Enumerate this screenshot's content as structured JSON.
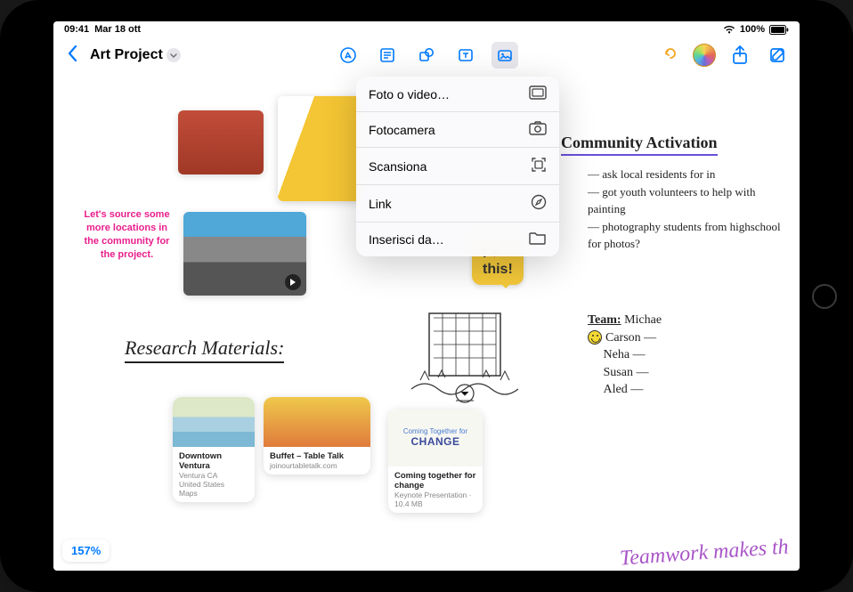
{
  "status": {
    "time": "09:41",
    "date": "Mar 18 ott",
    "battery_pct": "100%"
  },
  "header": {
    "title": "Art Project"
  },
  "menu": {
    "items": [
      {
        "label": "Foto o video…",
        "icon": "photos-icon"
      },
      {
        "label": "Fotocamera",
        "icon": "camera-icon"
      },
      {
        "label": "Scansiona",
        "icon": "scan-icon"
      },
      {
        "label": "Link",
        "icon": "compass-icon"
      },
      {
        "label": "Inserisci da…",
        "icon": "folder-icon"
      }
    ]
  },
  "canvas": {
    "pink_note": "Let's source some more locations in the community for the project.",
    "callout_line1": "I",
    "callout_line2": "this!",
    "research_title": "Research Materials:",
    "community_title": "Community Activation",
    "community_items": [
      "ask local residents for in",
      "got youth volunteers to help with painting",
      "photography students from highschool for photos?"
    ],
    "team_label": "Team:",
    "team_members": [
      "Michae",
      "Carson",
      "Neha",
      "Susan",
      "Aled"
    ],
    "teamwork_text": "Teamwork makes th"
  },
  "cards": {
    "map": {
      "title": "Downtown Ventura",
      "sub1": "Ventura CA",
      "sub2": "United States",
      "src": "Maps"
    },
    "buffet": {
      "title": "Buffet – Table Talk",
      "sub": "joinourtabletalk.com"
    },
    "change": {
      "logo_top": "Coming Together for",
      "logo_big": "CHANGE",
      "title": "Coming together for change",
      "sub": "Keynote Presentation · 10.4 MB"
    }
  },
  "zoom": "157%"
}
